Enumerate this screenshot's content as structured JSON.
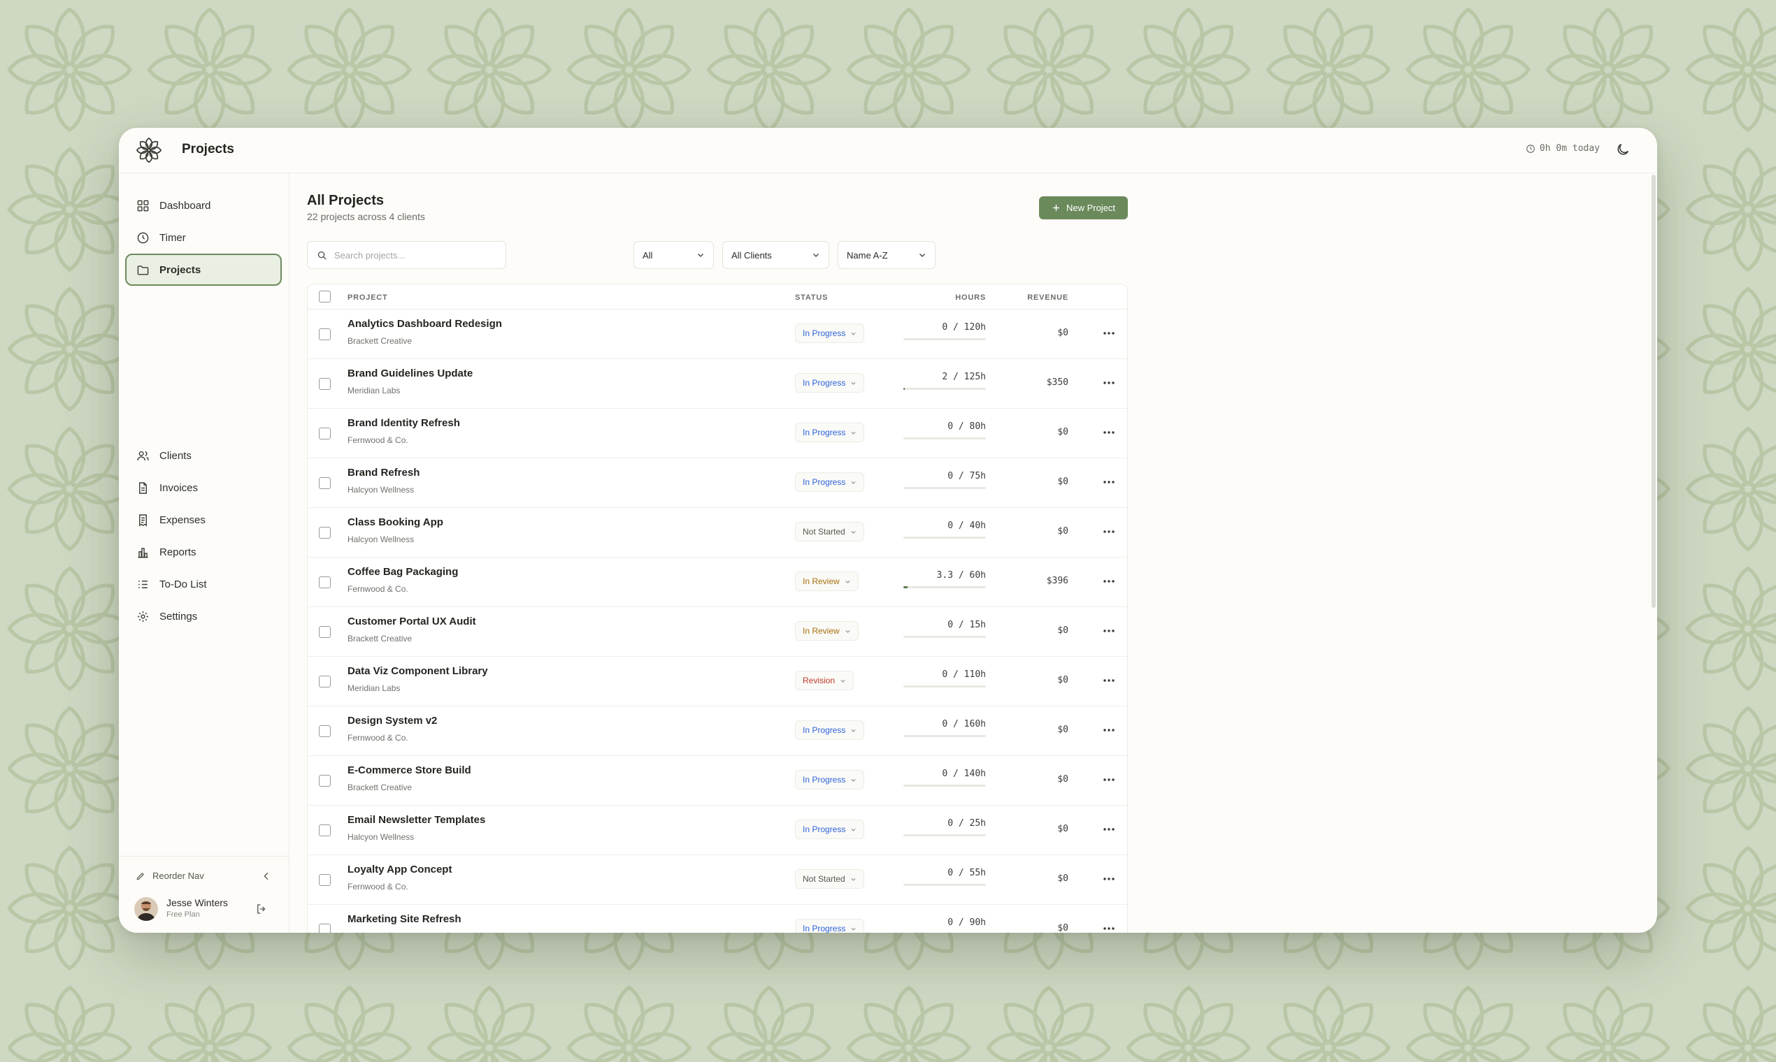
{
  "app": {
    "title": "Projects",
    "timer_today": "0h 0m today"
  },
  "colors": {
    "accent": "#6b8a5c",
    "background": "#cfd8c3",
    "in_progress": "#2f62d8",
    "in_review": "#a8700c",
    "revision": "#c0392b",
    "not_started": "#55574f"
  },
  "sidebar": {
    "items": [
      {
        "label": "Dashboard",
        "icon": "dashboard-icon"
      },
      {
        "label": "Timer",
        "icon": "clock-icon"
      },
      {
        "label": "Projects",
        "icon": "folder-icon",
        "active": true
      },
      {
        "label": "Clients",
        "icon": "users-icon"
      },
      {
        "label": "Invoices",
        "icon": "invoice-icon"
      },
      {
        "label": "Expenses",
        "icon": "receipt-icon"
      },
      {
        "label": "Reports",
        "icon": "bar-chart-icon"
      },
      {
        "label": "To-Do List",
        "icon": "checklist-icon"
      },
      {
        "label": "Settings",
        "icon": "gear-icon"
      }
    ],
    "reorder_label": "Reorder Nav",
    "user": {
      "name": "Jesse Winters",
      "plan": "Free Plan"
    }
  },
  "main": {
    "title": "All Projects",
    "subtitle": "22 projects across 4 clients",
    "new_button": "New Project",
    "search_placeholder": "Search projects...",
    "filters": {
      "status": "All",
      "client": "All Clients",
      "sort": "Name A-Z"
    },
    "columns": {
      "project": "PROJECT",
      "status": "STATUS",
      "hours": "HOURS",
      "revenue": "REVENUE"
    },
    "rows": [
      {
        "name": "Analytics Dashboard Redesign",
        "client": "Brackett Creative",
        "status": "In Progress",
        "hours_used": "0",
        "hours_budget": "120h",
        "hours_display": "0 / 120h",
        "progress": 0,
        "revenue": "$0"
      },
      {
        "name": "Brand Guidelines Update",
        "client": "Meridian Labs",
        "status": "In Progress",
        "hours_used": "2",
        "hours_budget": "125h",
        "hours_display": "2 / 125h",
        "progress": 0.016,
        "revenue": "$350"
      },
      {
        "name": "Brand Identity Refresh",
        "client": "Fernwood & Co.",
        "status": "In Progress",
        "hours_used": "0",
        "hours_budget": "80h",
        "hours_display": "0 / 80h",
        "progress": 0,
        "revenue": "$0"
      },
      {
        "name": "Brand Refresh",
        "client": "Halcyon Wellness",
        "status": "In Progress",
        "hours_used": "0",
        "hours_budget": "75h",
        "hours_display": "0 / 75h",
        "progress": 0,
        "revenue": "$0"
      },
      {
        "name": "Class Booking App",
        "client": "Halcyon Wellness",
        "status": "Not Started",
        "hours_used": "0",
        "hours_budget": "40h",
        "hours_display": "0 / 40h",
        "progress": 0,
        "revenue": "$0"
      },
      {
        "name": "Coffee Bag Packaging",
        "client": "Fernwood & Co.",
        "status": "In Review",
        "hours_used": "3.3",
        "hours_budget": "60h",
        "hours_display": "3.3 / 60h",
        "progress": 0.055,
        "revenue": "$396"
      },
      {
        "name": "Customer Portal UX Audit",
        "client": "Brackett Creative",
        "status": "In Review",
        "hours_used": "0",
        "hours_budget": "15h",
        "hours_display": "0 / 15h",
        "progress": 0,
        "revenue": "$0"
      },
      {
        "name": "Data Viz Component Library",
        "client": "Meridian Labs",
        "status": "Revision",
        "hours_used": "0",
        "hours_budget": "110h",
        "hours_display": "0 / 110h",
        "progress": 0,
        "revenue": "$0"
      },
      {
        "name": "Design System v2",
        "client": "Fernwood & Co.",
        "status": "In Progress",
        "hours_used": "0",
        "hours_budget": "160h",
        "hours_display": "0 / 160h",
        "progress": 0,
        "revenue": "$0"
      },
      {
        "name": "E-Commerce Store Build",
        "client": "Brackett Creative",
        "status": "In Progress",
        "hours_used": "0",
        "hours_budget": "140h",
        "hours_display": "0 / 140h",
        "progress": 0,
        "revenue": "$0"
      },
      {
        "name": "Email Newsletter Templates",
        "client": "Halcyon Wellness",
        "status": "In Progress",
        "hours_used": "0",
        "hours_budget": "25h",
        "hours_display": "0 / 25h",
        "progress": 0,
        "revenue": "$0"
      },
      {
        "name": "Loyalty App Concept",
        "client": "Fernwood & Co.",
        "status": "Not Started",
        "hours_used": "0",
        "hours_budget": "55h",
        "hours_display": "0 / 55h",
        "progress": 0,
        "revenue": "$0"
      },
      {
        "name": "Marketing Site Refresh",
        "client": "",
        "status": "In Progress",
        "hours_used": "0",
        "hours_budget": "90h",
        "hours_display": "0 / 90h",
        "progress": 0,
        "revenue": "$0"
      }
    ]
  }
}
